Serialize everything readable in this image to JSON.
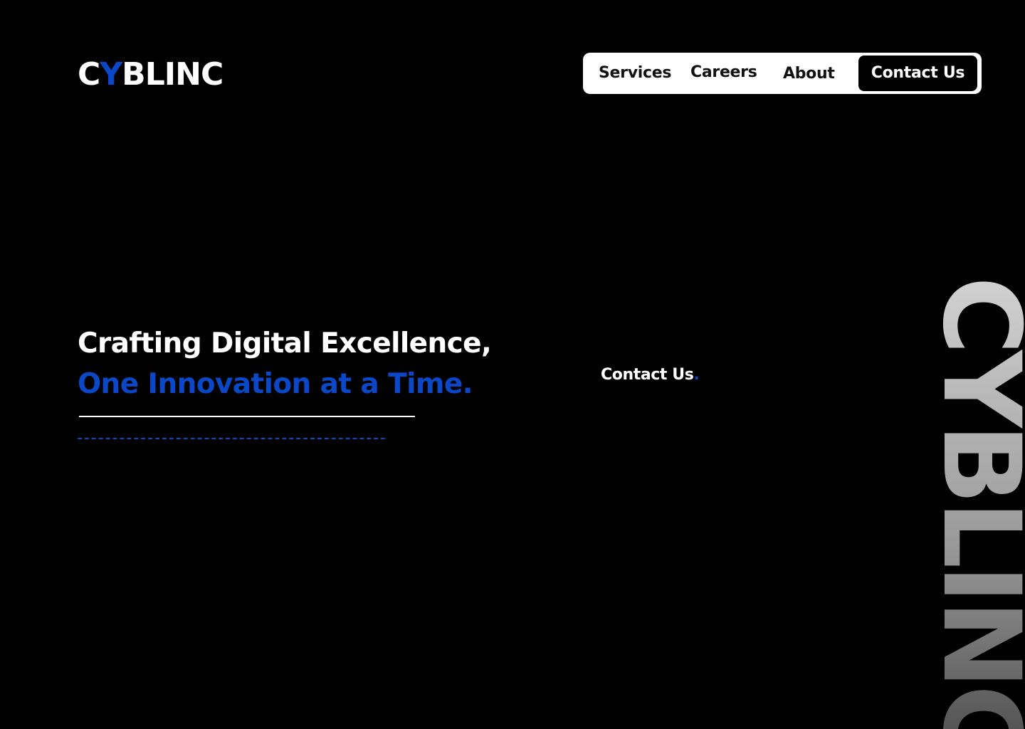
{
  "brand": {
    "logo_prefix": "C",
    "logo_accent": "Y",
    "logo_suffix": "BLINC",
    "accent_color": "#0a48c8"
  },
  "nav": {
    "items": [
      {
        "label": "Services"
      },
      {
        "label": "Careers"
      },
      {
        "label": "About"
      }
    ],
    "cta_label": "Contact Us"
  },
  "hero": {
    "headline_line1": "Crafting Digital Excellence,",
    "headline_line2": "One Innovation at a Time."
  },
  "contact_link": {
    "label": "Contact Us",
    "suffix": "."
  },
  "vertical_wordmark": "CYBLINC"
}
